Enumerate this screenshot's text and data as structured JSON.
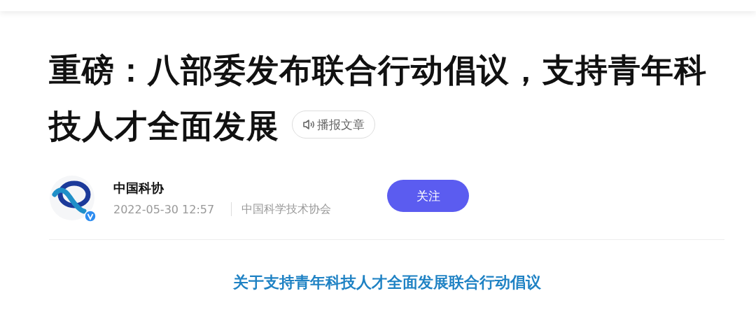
{
  "title": "重磅：八部委发布联合行动倡议，支持青年科技人才全面发展",
  "listen_button": {
    "label": "播报文章"
  },
  "author": {
    "name": "中国科协",
    "verified": true,
    "date": "2022-05-30 12:57",
    "source": "中国科学技术协会"
  },
  "follow_button": {
    "label": "关注"
  },
  "section_heading": "关于支持青年科技人才全面发展联合行动倡议"
}
